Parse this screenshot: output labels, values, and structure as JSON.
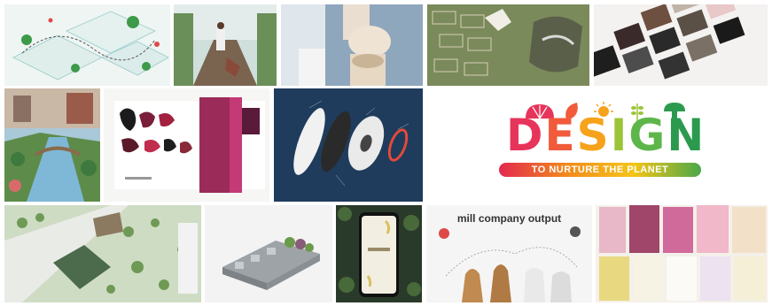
{
  "logo": {
    "letters": [
      "D",
      "E",
      "S",
      "I",
      "G",
      "N"
    ],
    "letter_colors": [
      "#e7345a",
      "#f15a3a",
      "#f6a21a",
      "#9bc43a",
      "#5eb64b",
      "#2c9a4e"
    ],
    "tagline": "TO NURTURE THE PLANET",
    "tagline_gradient": [
      "#e3284f",
      "#f28a1c",
      "#f5c518",
      "#4aa84a"
    ],
    "icons": [
      "shell-icon",
      "leaf-icon",
      "sun-icon",
      "wheat-icon",
      "mushroom-icon"
    ]
  },
  "tiles": {
    "mill_chart_title": "mill company output"
  }
}
